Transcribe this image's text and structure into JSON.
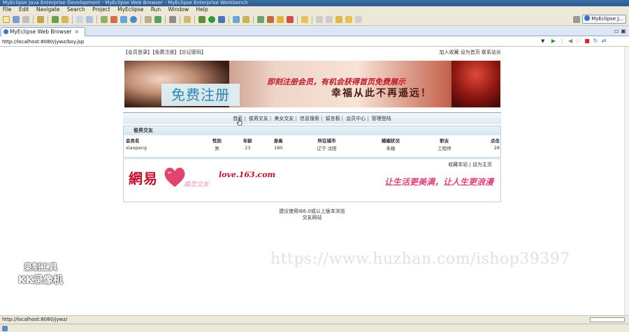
{
  "window": {
    "title": "MyEclipse Java Enterprise Development - MyEclipse Web Browser - MyEclipse Enterprise Workbench"
  },
  "menu": [
    "File",
    "Edit",
    "Navigate",
    "Search",
    "Project",
    "MyEclipse",
    "Run",
    "Window",
    "Help"
  ],
  "perspective": {
    "label": "MyEclipse J..."
  },
  "view_tab": {
    "label": "MyEclipse Web Browser",
    "close": "×"
  },
  "view_buttons": "▭ ▣",
  "address": {
    "value": "http://localhost:8080/jywz/boy.jsp"
  },
  "page": {
    "topnav_left": "【会员登录】【免费注册】【忘记密码】",
    "topnav_right": "加入收藏  设为首页  联系站长",
    "banner": {
      "reg_text": "免费注册",
      "slogan1": "即刻注册会员，有机会获得首页免费展示",
      "slogan2": "幸福从此不再遥远！"
    },
    "mainnav": [
      "首页",
      "俊男交友",
      "美女交友",
      "信息搜索",
      "留言板",
      "会员中心",
      "管理登陆"
    ],
    "list": {
      "title": "俊男交友",
      "columns": [
        "会员名",
        "性别",
        "年龄",
        "身高",
        "所在城市",
        "婚姻状况",
        "职业",
        "点击"
      ],
      "rows": [
        [
          "xiaopeng",
          "男",
          "23",
          "180",
          "辽宁 沈阳",
          "未婚",
          "工程师",
          "28"
        ]
      ]
    },
    "footer": {
      "links": "收藏本站  |  设为主页",
      "logo_cn": "網易",
      "love_url": "love.163.com",
      "love_sub": "婚恋交友",
      "motto": "让生活更美满，让人生更浪漫"
    },
    "copyright": [
      "建议使用IE6.0或以上版本浏览",
      "交友网站"
    ]
  },
  "status": {
    "text": "http://localhost:8080/jywz/"
  },
  "overlay": {
    "watermark": "https://www.huzhan.com/ishop39397",
    "recorder_line1": "录制工具",
    "recorder_line2": "KK录像机"
  }
}
